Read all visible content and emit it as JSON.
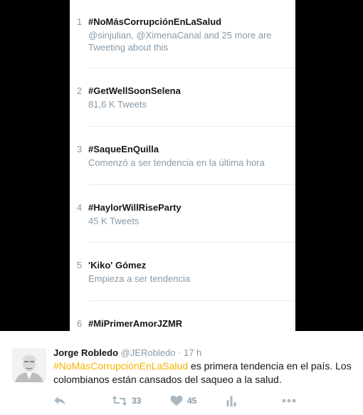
{
  "trends": [
    {
      "rank": "1",
      "name": "#NoMásCorrupciónEnLaSalud",
      "meta": "@sinjulian, @XimenaCanal and 25 more are Tweeting about this"
    },
    {
      "rank": "2",
      "name": "#GetWellSoonSelena",
      "meta": "81,6 K Tweets"
    },
    {
      "rank": "3",
      "name": "#SaqueEnQuilla",
      "meta": "Comenzó a ser tendencia en la última hora"
    },
    {
      "rank": "4",
      "name": "#HaylorWillRiseParty",
      "meta": "45 K Tweets"
    },
    {
      "rank": "5",
      "name": "'Kiko' Gómez",
      "meta": "Empieza a ser tendencia"
    },
    {
      "rank": "6",
      "name": "#MiPrimerAmorJZMR",
      "meta": ""
    }
  ],
  "tweet": {
    "author_name": "Jorge Robledo",
    "handle": "@JERobledo",
    "separator": "·",
    "time": "17 h",
    "hashtag": "#NoMásCorrupciónEnLaSalud",
    "text_after_hashtag": " es primera tendencia en el país. Los colombianos están cansados del saqueo a la salud.",
    "retweet_count": "33",
    "like_count": "45"
  },
  "colors": {
    "hashtag": "#f5b400",
    "muted": "#8899a6",
    "text": "#14171a",
    "background": "#000000"
  },
  "icons": {
    "reply": "reply-icon",
    "retweet": "retweet-icon",
    "like": "heart-icon",
    "analytics": "analytics-icon",
    "more": "more-icon"
  }
}
